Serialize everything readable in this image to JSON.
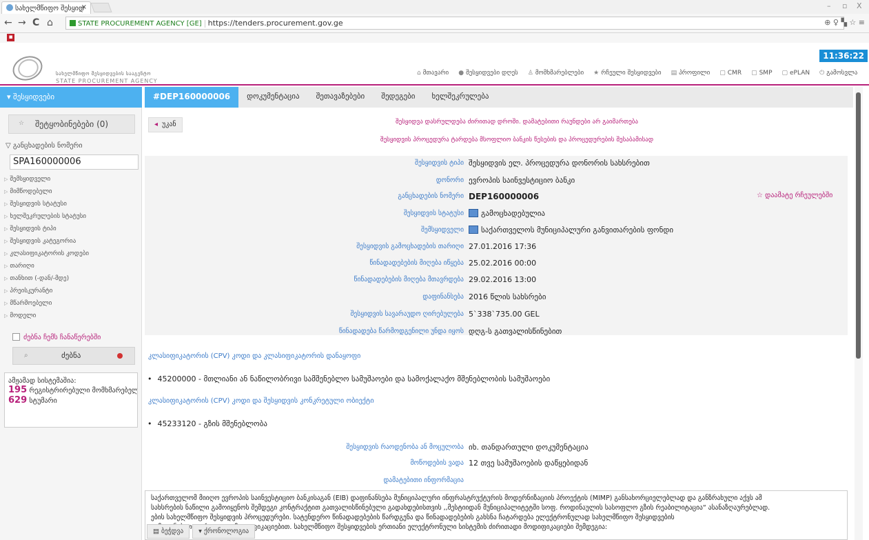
{
  "browser": {
    "tab_title": "სახელმწიფო შესყიდ",
    "tab_close": "×",
    "window_controls": [
      "–",
      "▫",
      "X"
    ],
    "back": "←",
    "forward": "→",
    "reload": "C",
    "home": "⌂",
    "ev_label": "STATE PROCUREMENT AGENCY [GE]",
    "url": "https://tenders.procurement.gov.ge",
    "ext_icons": "⊕ ♀ ▚ ☆ ≡"
  },
  "site": {
    "logo_ge": "სახელმწიფო შესყიდვების სააგენტო",
    "logo_en": "STATE PROCUREMENT AGENCY",
    "clock": "11:36:22",
    "topnav": [
      {
        "icon": "⌂",
        "label": "მთავარი"
      },
      {
        "icon": "●",
        "label": "შესყიდვები დღეს"
      },
      {
        "icon": "♙",
        "label": "მომხმარებლები"
      },
      {
        "icon": "★",
        "label": "რჩეული შესყიდვები"
      },
      {
        "icon": "▤",
        "label": "პროფილი"
      },
      {
        "icon": "▢",
        "label": "CMR"
      },
      {
        "icon": "▢",
        "label": "SMP"
      },
      {
        "icon": "▢",
        "label": "ePLAN"
      },
      {
        "icon": "⏻",
        "label": "გამოსვლა"
      }
    ]
  },
  "sidebar": {
    "header": "▾ შესყიდვები",
    "notif_label": "შეტყობინებები (0)",
    "notif_star": "☆",
    "filter_label": "▽ განცხადების ნომერი",
    "filter_value": "SPA160000006",
    "filters": [
      "შემსყიდველი",
      "მიმწოდებელი",
      "შესყიდვის სტატუსი",
      "ხელშეკრულების სტატუსი",
      "შესყიდვის ტიპი",
      "შესყიდვის კატეგორია",
      "კლასიფიკატორის კოდები",
      "თარიღი",
      "თანხით (-დან/-მდე)",
      "პრეისკურანტი",
      "მწარმოებელი",
      "მოდელი"
    ],
    "mine_label": "ძებნა ჩემს ჩანაწერებში",
    "search_label": "ძებნა",
    "search_icon": "⌕",
    "stats_title": "ამჟამად სისტემაშია:",
    "stats_users_n": "195",
    "stats_users_label": " რეგისტრირებული მომხმარებელი",
    "stats_guests_n": "629",
    "stats_guests_label": " სტუმარი"
  },
  "main": {
    "tabs": [
      "#DEP160000006",
      "დოკუმენტაცია",
      "შეთავაზებები",
      "შედეგები",
      "ხელშეკრულება"
    ],
    "back_label": "უკან",
    "notice1": "შესყიდვა დასრულდება ძირითად დროში. დამატებითი რაუნდები არ გაიმართება",
    "notice2": "შესყიდვის პროცედურა ტარდება მსოფლიო ბანკის წესების და პროცედურების შესაბამისად",
    "fields": [
      {
        "k": "შესყიდვის ტიპი",
        "v": "შესყიდვის ელ. პროცედურა დონორის სახსრებით",
        "b": false,
        "flag": false
      },
      {
        "k": "დონორი",
        "v": "ევროპის საინვესტიციო ბანკი",
        "b": false,
        "flag": false
      },
      {
        "k": "განცხადების ნომერი",
        "v": "DEP160000006",
        "b": true,
        "flag": false
      },
      {
        "k": "შესყიდვის სტატუსი",
        "v": "გამოცხადებულია",
        "b": false,
        "flag": true
      },
      {
        "k": "შემსყიდველი",
        "v": "საქართველოს მუნიციპალური განვითარების ფონდი",
        "b": false,
        "flag": true
      },
      {
        "k": "შესყიდვის გამოცხადების თარიღი",
        "v": "27.01.2016 17:36",
        "b": false,
        "flag": false
      },
      {
        "k": "წინადადებების მიღება იწყება",
        "v": "25.02.2016 00:00",
        "b": false,
        "flag": false
      },
      {
        "k": "წინადადებების მიღება მთავრდება",
        "v": "29.02.2016 13:00",
        "b": false,
        "flag": false
      },
      {
        "k": "დაფინანსება",
        "v": "2016 წლის სახსრები",
        "b": false,
        "flag": false
      },
      {
        "k": "შესყიდვის სავარაუდო ღირებულება",
        "v": "5`338`735.00 GEL",
        "b": false,
        "flag": false
      },
      {
        "k": "წინადადება წარმოდგენილი უნდა იყოს",
        "v": "დღგ-ს გათვალისწინებით",
        "b": false,
        "flag": false
      }
    ],
    "fav_label": "☆ დაამატე რჩეულებში",
    "cpv_link1": "კლასიფიკატორის (CPV) კოდი და კლასიფიკატორის დანაყოფი",
    "cpv1": "45200000 - მთლიანი ან ნაწილობრივი სამშენებლო სამუშაოები და სამოქალაქო მშენებლობის სამუშაოები",
    "cpv_link2": "კლასიფიკატორის (CPV) კოდი და შესყიდვის კონკრეტული ობიექტი",
    "cpv2": "45233120 - გზის მშენებლობა",
    "extra": [
      {
        "k": "შესყიდვის რაოდენობა ან მოცულობა",
        "v": "იხ. თანდართული დოკუმენტაცია"
      },
      {
        "k": "მოწოდების ვადა",
        "v": "12 თვე სამუშაოების დაწყებიდან"
      }
    ],
    "more_info": "დამატებითი ინფორმაცია",
    "desc_lines": [
      "საქართველომ მიიღო ევროპის საინვესტიციო ბანკისაგან (EIB) დაფინანსება მუნიციპალური ინფრასტრუქტურის მოდერნიზაციის პროექტის (MIMP) განსახორციელებლად და განზრახული აქვს ამ",
      "სახსრების ნაწილი გამოიყენოს შემდეგი კონტრაქტით გათვალისწინებული გადახდებისთვის ,,მესტიიდან მუნიციპალიტეტში სოფ. როდინაულის სასოფლო გზის რეაბილიტაცია“ ასანაზღაურებლად.",
      "ების სახელმწიფო შესყიდვის პროცედურები. სატენდერო წინადადებების წარდგენა და წინადადებების გახსნა ჩატარდება ელექტრონულად სახელმწიფო შესყიდვების",
      "გამოყენებით, გარკვეული მოდიფიკაციებით. სახელმწიფო შესყიდვების ერთიანი ელექტრონული სისტემის ძირითადი მოდიფიკაციები შემდეგია:"
    ],
    "print_label": "▤ ბეჭდვა",
    "chrono_label": "▾ ქრონოლოგია"
  }
}
